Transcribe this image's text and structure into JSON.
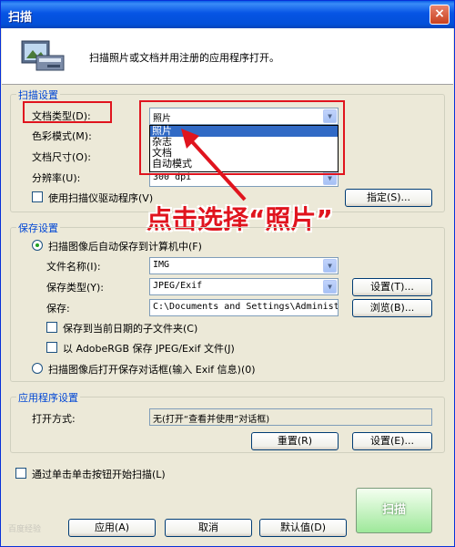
{
  "window": {
    "title": "扫描",
    "close_glyph": "×"
  },
  "header": {
    "description": "扫描照片或文档并用注册的应用程序打开。",
    "icon": "scanner-photo-icon"
  },
  "scan_settings": {
    "group_title": "扫描设置",
    "doc_type_label": "文档类型(D):",
    "doc_type_value": "照片",
    "color_mode_label": "色彩模式(M):",
    "doc_size_label": "文档尺寸(O):",
    "resolution_label": "分辨率(U):",
    "resolution_value": "300 dpi",
    "use_driver_label": "使用扫描仪驱动程序(V)",
    "specify_button": "指定(S)...",
    "dropdown_options": [
      "照片",
      "杂志",
      "文档",
      "自动模式"
    ]
  },
  "annotation": {
    "text": "点击选择“照片”",
    "color": "#E0141E"
  },
  "save_settings": {
    "group_title": "保存设置",
    "auto_save_label": "扫描图像后自动保存到计算机中(F)",
    "file_name_label": "文件名称(I):",
    "file_name_value": "IMG",
    "save_type_label": "保存类型(Y):",
    "save_type_value": "JPEG/Exif",
    "settings_button": "设置(T)...",
    "save_in_label": "保存:",
    "save_in_value": "C:\\Documents and Settings\\Administ",
    "browse_button": "浏览(B)...",
    "subfolder_label": "保存到当前日期的子文件夹(C)",
    "adobergb_label": "以 AdobeRGB 保存 JPEG/Exif 文件(J)",
    "open_dialog_label": "扫描图像后打开保存对话框(输入 Exif 信息)(0)"
  },
  "app_settings": {
    "group_title": "应用程序设置",
    "open_method_label": "打开方式:",
    "open_method_value": "无(打开“查看并使用”对话框)",
    "reset_button": "重置(R)",
    "settings_button": "设置(E)..."
  },
  "footer": {
    "single_click_label": "通过单击单击按钮开始扫描(L)",
    "scan_button": "扫描",
    "apply_button": "应用(A)",
    "cancel_button": "取消",
    "default_button": "默认值(D)"
  }
}
